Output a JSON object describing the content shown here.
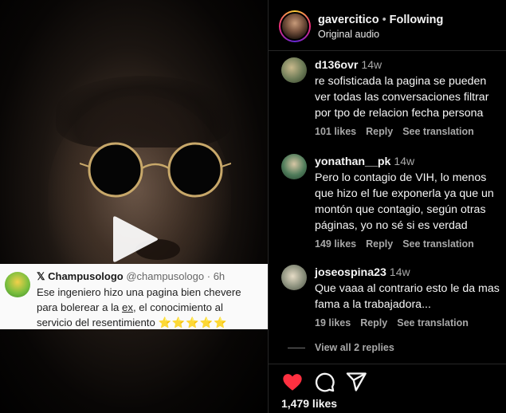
{
  "tweet": {
    "x_glyph": "𝕏",
    "name": "Champusologo",
    "handle": "@champusologo",
    "time": "6h",
    "line1": "Ese ingeniero hizo una pagina bien chevere",
    "line2_a": "para bolerear a la ",
    "line2_u": "ex",
    "line2_b": ", el conocimiento al",
    "line3": "servicio del resentimiento",
    "stars": "⭐⭐⭐⭐⭐"
  },
  "header": {
    "username": "gavercitico",
    "separator": "•",
    "follow_status": "Following",
    "audio": "Original audio"
  },
  "comments": [
    {
      "user": "d136ovr",
      "time": "14w",
      "text_lines": [
        "re sofisticada la pagina se pueden",
        "ver todas las conversaciones filtrar",
        "por tpo de relacion fecha persona"
      ],
      "likes": "101 likes",
      "reply": "Reply",
      "translate": "See translation",
      "avatar_color": "#6b7a56"
    },
    {
      "user": "yonathan__pk",
      "time": "14w",
      "text_lines": [
        "Pero lo contagio de VIH, lo menos",
        "que hizo el fue exponerla ya que un",
        "montón que contagio, según otras",
        "páginas, yo no sé si es verdad"
      ],
      "likes": "149 likes",
      "reply": "Reply",
      "translate": "See translation",
      "avatar_color": "#4f7b5a"
    },
    {
      "user": "joseospina23",
      "time": "14w",
      "text_lines": [
        "Que vaaa al contrario esto le da mas",
        "fama a la trabajadora..."
      ],
      "likes": "19 likes",
      "reply": "Reply",
      "translate": "See translation",
      "avatar_color": "#8a8f7c"
    }
  ],
  "view_replies": "View all 2 replies",
  "actions": {
    "like_icon": "heart-filled-icon",
    "comment_icon": "comment-icon",
    "share_icon": "share-icon",
    "like_color": "#ff3040",
    "likes_count": "1,479 likes"
  }
}
